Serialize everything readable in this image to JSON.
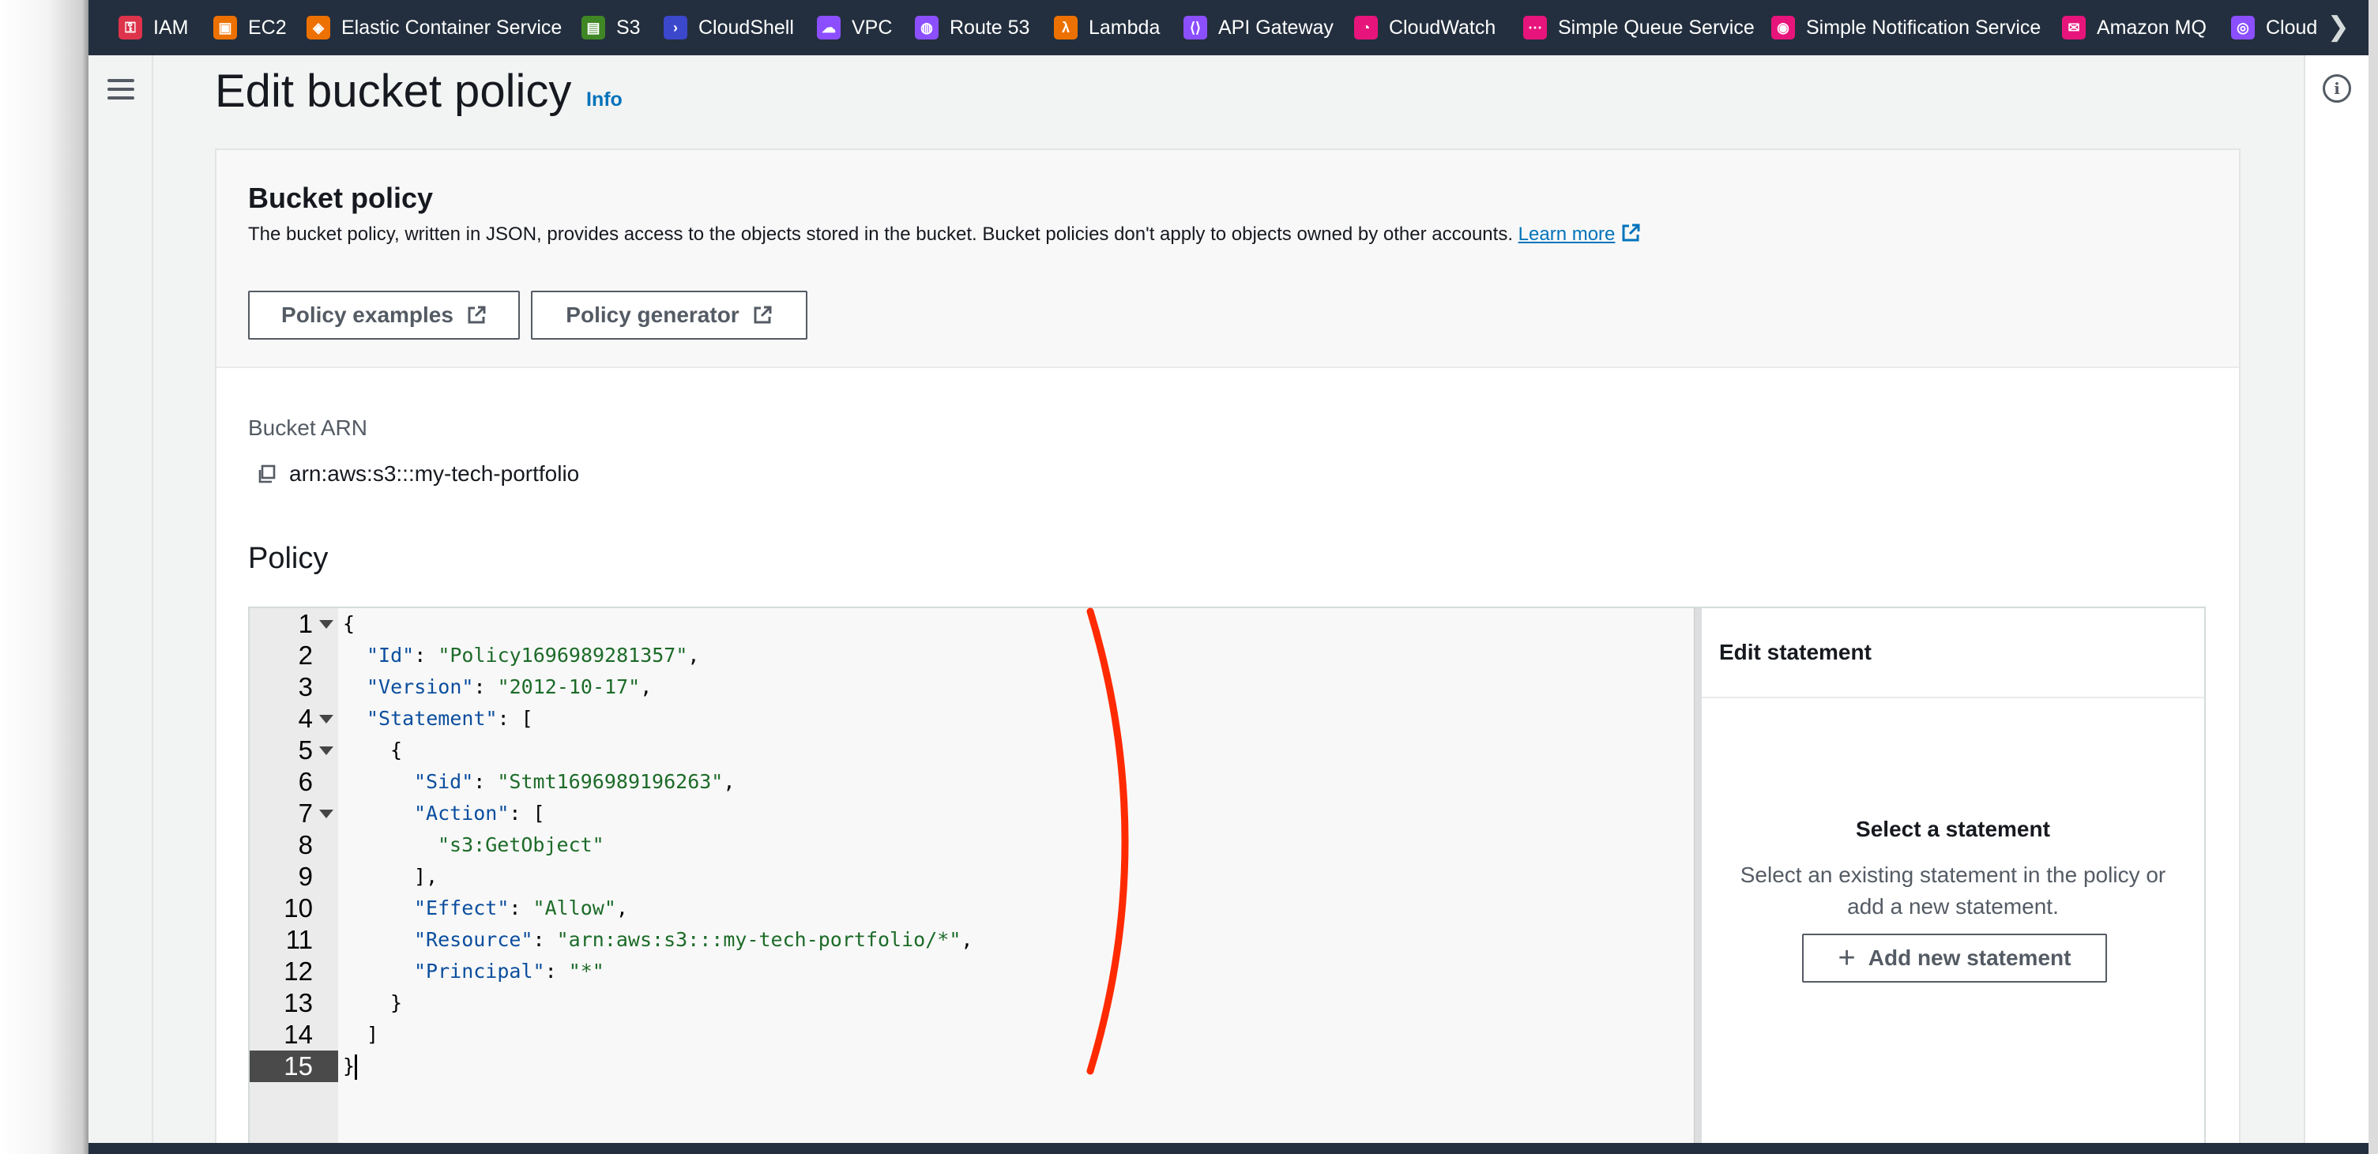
{
  "nav": {
    "favorites": [
      {
        "label": "IAM",
        "icon": "iam-icon",
        "color": "#dd344c"
      },
      {
        "label": "EC2",
        "icon": "ec2-icon",
        "color": "#ed7100"
      },
      {
        "label": "Elastic Container Service",
        "icon": "ecs-icon",
        "color": "#ed7100"
      },
      {
        "label": "S3",
        "icon": "s3-icon",
        "color": "#3f8624"
      },
      {
        "label": "CloudShell",
        "icon": "cloudshell-icon",
        "color": "#3b48cc"
      },
      {
        "label": "VPC",
        "icon": "vpc-icon",
        "color": "#8c4fff"
      },
      {
        "label": "Route 53",
        "icon": "route53-icon",
        "color": "#8c4fff"
      },
      {
        "label": "Lambda",
        "icon": "lambda-icon",
        "color": "#ed7100"
      },
      {
        "label": "API Gateway",
        "icon": "api-gateway-icon",
        "color": "#8c4fff"
      },
      {
        "label": "CloudWatch",
        "icon": "cloudwatch-icon",
        "color": "#e7157b"
      },
      {
        "label": "Simple Queue Service",
        "icon": "sqs-icon",
        "color": "#e7157b"
      },
      {
        "label": "Simple Notification Service",
        "icon": "sns-icon",
        "color": "#e7157b"
      },
      {
        "label": "Amazon MQ",
        "icon": "mq-icon",
        "color": "#e7157b"
      },
      {
        "label": "Cloud",
        "icon": "cloud-service-icon",
        "color": "#8c4fff"
      }
    ]
  },
  "page": {
    "title": "Edit bucket policy",
    "info_link": "Info"
  },
  "bucket_policy": {
    "heading": "Bucket policy",
    "description": "The bucket policy, written in JSON, provides access to the objects stored in the bucket. Bucket policies don't apply to objects owned by other accounts.",
    "learn_more": "Learn more",
    "examples_button": "Policy examples",
    "generator_button": "Policy generator"
  },
  "arn": {
    "label": "Bucket ARN",
    "value": "arn:aws:s3:::my-tech-portfolio"
  },
  "policy": {
    "label": "Policy",
    "line_numbers": [
      "1",
      "2",
      "3",
      "4",
      "5",
      "6",
      "7",
      "8",
      "9",
      "10",
      "11",
      "12",
      "13",
      "14",
      "15"
    ],
    "active_line": "15",
    "code": {
      "l1": "{",
      "id_key": "\"Id\"",
      "id_val": "\"Policy1696989281357\"",
      "version_key": "\"Version\"",
      "version_val": "\"2012-10-17\"",
      "statement_key": "\"Statement\"",
      "l5": "{",
      "sid_key": "\"Sid\"",
      "sid_val": "\"Stmt1696989196263\"",
      "action_key": "\"Action\"",
      "action_val": "\"s3:GetObject\"",
      "l9": "],",
      "effect_key": "\"Effect\"",
      "effect_val": "\"Allow\"",
      "resource_key": "\"Resource\"",
      "resource_val": "\"arn:aws:s3:::my-tech-portfolio/*\"",
      "principal_key": "\"Principal\"",
      "principal_val": "\"*\"",
      "l13": "}",
      "l14": "]",
      "l15": "}"
    }
  },
  "edit_statement": {
    "heading": "Edit statement",
    "empty_title": "Select a statement",
    "empty_desc": "Select an existing statement in the policy or add a new statement.",
    "add_button": "Add new statement"
  },
  "colors": {
    "nav_bg": "#232f3e",
    "link": "#0073bb",
    "annotation": "#ff2a00"
  }
}
